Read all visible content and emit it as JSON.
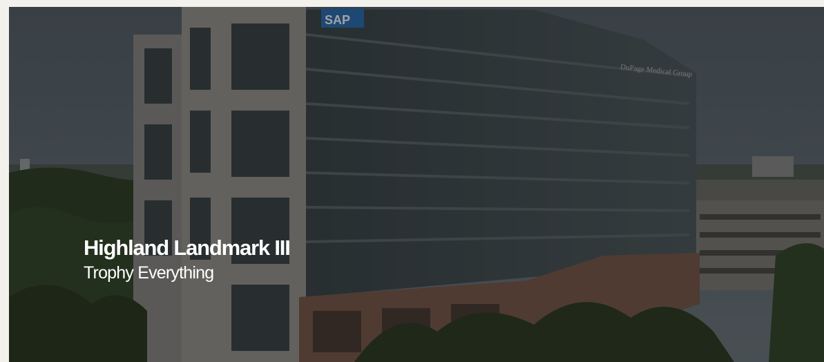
{
  "hero": {
    "title": "Highland Landmark III",
    "subtitle": "Trophy Everything",
    "signs": {
      "rooftop_logo": "SAP",
      "facade_sign": "DuPage Medical Group"
    }
  },
  "colors": {
    "page_background": "#f2f1ec",
    "sky": "#5e6d78",
    "glass": "#3e4a4f",
    "stone": "#8c8a86",
    "brick": "#7a5a4a",
    "trees": "#2f3f26",
    "text": "#ffffff"
  }
}
